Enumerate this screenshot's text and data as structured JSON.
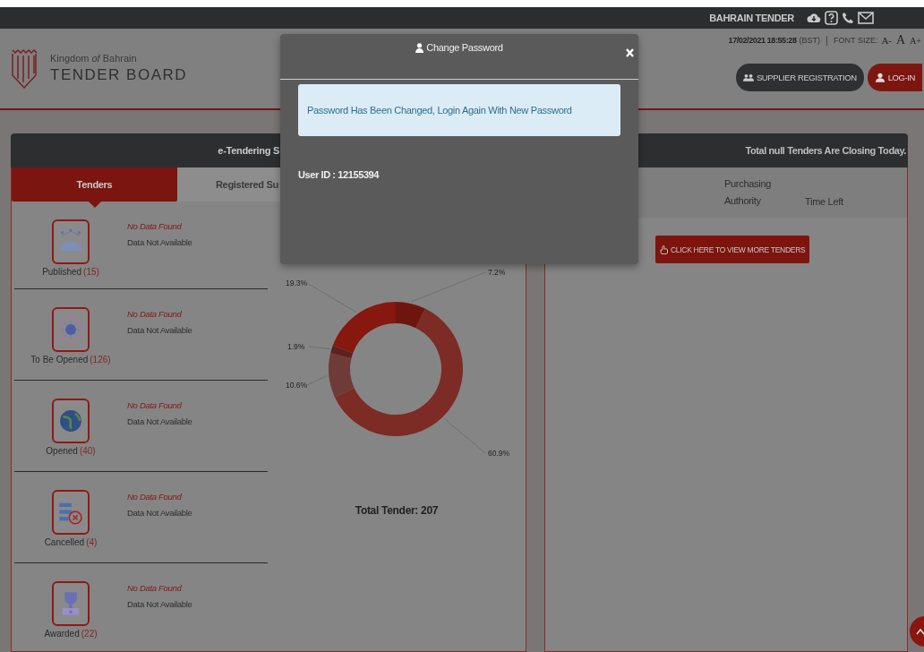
{
  "top_bar": {
    "site_name": "BAHRAIN TENDER"
  },
  "header": {
    "logo_line1": "Kingdom *of* Bahrain",
    "logo_line2": "TENDER BOARD",
    "datetime": "17/02/2021 18:55:28",
    "timezone": "(BST)",
    "font_size_label": "FONT SIZE:",
    "font_size_buttons": [
      "A-",
      "A",
      "A+"
    ],
    "buttons": [
      {
        "kind": "dark",
        "label": "SUPPLIER REGISTRATION"
      },
      {
        "kind": "primary",
        "label": "LOG-IN"
      }
    ]
  },
  "dashboard": {
    "title": "e-Tendering S",
    "closing_notice": "Total null Tenders Are Closing Today.",
    "tabs": [
      {
        "label": "Tenders",
        "selected": true
      },
      {
        "label": "Registered Su",
        "selected": false
      }
    ],
    "tender_categories": [
      {
        "kind": "published",
        "label": "Published",
        "count": "(15)",
        "status": "No Data Found",
        "detail": "Data Not Available"
      },
      {
        "kind": "to_be_opened",
        "label": "To Be Opened",
        "count": "(126)",
        "status": "No Data Found",
        "detail": "Data Not Available"
      },
      {
        "kind": "opened",
        "label": "Opened",
        "count": "(40)",
        "status": "No Data Found",
        "detail": "Data Not Available"
      },
      {
        "kind": "cancelled",
        "label": "Cancelled",
        "count": "(4)",
        "status": "No Data Found",
        "detail": "Data Not Available"
      },
      {
        "kind": "awarded",
        "label": "Awarded",
        "count": "(22)",
        "status": "No Data Found",
        "detail": "Data Not Available"
      }
    ],
    "chart": {
      "chart_data": {
        "type": "donut",
        "values": [
          7.2,
          60.9,
          10.6,
          1.9,
          19.3
        ],
        "value_labels": [
          "7.2%",
          "60.9%",
          "10.6%",
          "1.9%",
          "19.3%"
        ]
      },
      "total": "Total Tender: 207"
    },
    "closing_table": {
      "columns": [
        "Purchasing Authority",
        "Time Left"
      ],
      "more_button": "CLICK HERE TO VIEW MORE TENDERS"
    }
  },
  "modal": {
    "title": "Change Password",
    "alert": "Password Has Been Changed, Login Again With New Password",
    "user_id": "User ID : 12155394"
  }
}
